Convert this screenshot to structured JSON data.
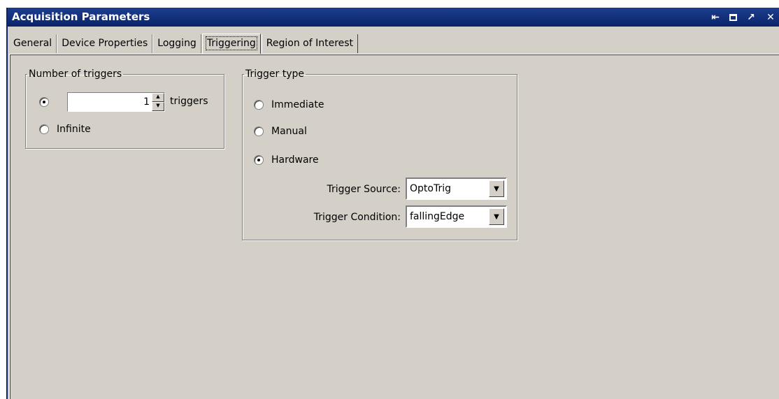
{
  "window": {
    "title": "Acquisition Parameters",
    "icons": [
      "pin-icon",
      "maximize-icon",
      "undock-icon",
      "close-icon"
    ]
  },
  "tabs": [
    {
      "label": "General"
    },
    {
      "label": "Device Properties"
    },
    {
      "label": "Logging"
    },
    {
      "label": "Triggering",
      "active": true
    },
    {
      "label": "Region of Interest"
    }
  ],
  "number_of_triggers": {
    "legend": "Number of triggers",
    "count_value": "1",
    "count_unit": "triggers",
    "count_selected": true,
    "infinite_label": "Infinite"
  },
  "trigger_type": {
    "legend": "Trigger type",
    "options": [
      {
        "label": "Immediate",
        "selected": false
      },
      {
        "label": "Manual",
        "selected": false
      },
      {
        "label": "Hardware",
        "selected": true
      }
    ],
    "source_label": "Trigger Source:",
    "source_value": "OptoTrig",
    "condition_label": "Trigger Condition:",
    "condition_value": "fallingEdge"
  },
  "colors": {
    "titlebar": "#0a246a",
    "dialog_bg": "#d4d0c8"
  }
}
